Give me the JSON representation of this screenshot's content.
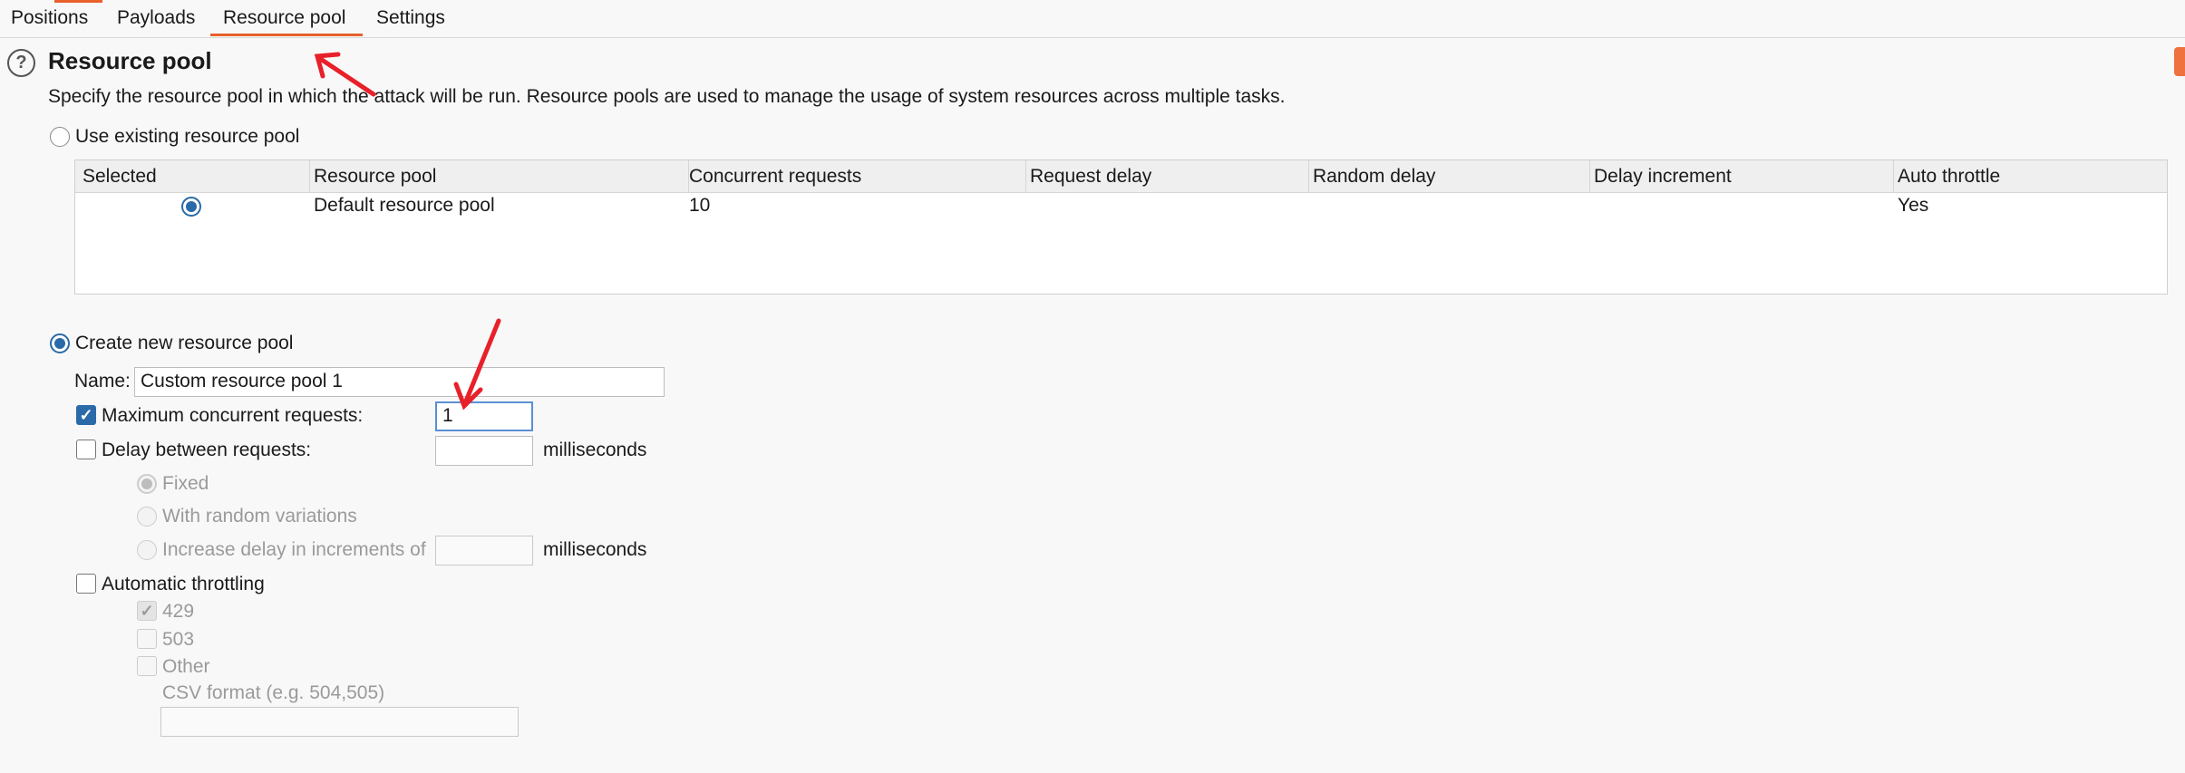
{
  "tabs": [
    {
      "label": "Positions"
    },
    {
      "label": "Payloads"
    },
    {
      "label": "Resource pool",
      "active": true
    },
    {
      "label": "Settings"
    }
  ],
  "section": {
    "title": "Resource pool",
    "description": "Specify the resource pool in which the attack will be run. Resource pools are used to manage the usage of system resources across multiple tasks."
  },
  "existing_pool": {
    "option_label": "Use existing resource pool",
    "selected": false,
    "columns": [
      "Selected",
      "Resource pool",
      "Concurrent requests",
      "Request delay",
      "Random delay",
      "Delay increment",
      "Auto throttle"
    ],
    "rows": [
      {
        "selected": true,
        "resource_pool": "Default resource pool",
        "concurrent_requests": "10",
        "request_delay": "",
        "random_delay": "",
        "delay_increment": "",
        "auto_throttle": "Yes"
      }
    ]
  },
  "new_pool": {
    "option_label": "Create new resource pool",
    "selected": true,
    "name_label": "Name:",
    "name_value": "Custom resource pool 1",
    "max_concurrent": {
      "label": "Maximum concurrent requests:",
      "checked": true,
      "value": "1"
    },
    "delay": {
      "label": "Delay between requests:",
      "checked": false,
      "value": "",
      "unit": "milliseconds",
      "options": {
        "fixed": "Fixed",
        "random": "With random variations",
        "increase": "Increase delay in increments of"
      },
      "increment_value": "",
      "increment_unit": "milliseconds"
    },
    "throttling": {
      "label": "Automatic throttling",
      "checked": false,
      "codes": {
        "c429": "429",
        "c503": "503",
        "other": "Other"
      },
      "csv_label": "CSV format (e.g. 504,505)",
      "csv_value": ""
    }
  },
  "colors": {
    "accent": "#e8602c",
    "selection": "#2a6aa8",
    "annotation_arrow": "#e8202a"
  }
}
